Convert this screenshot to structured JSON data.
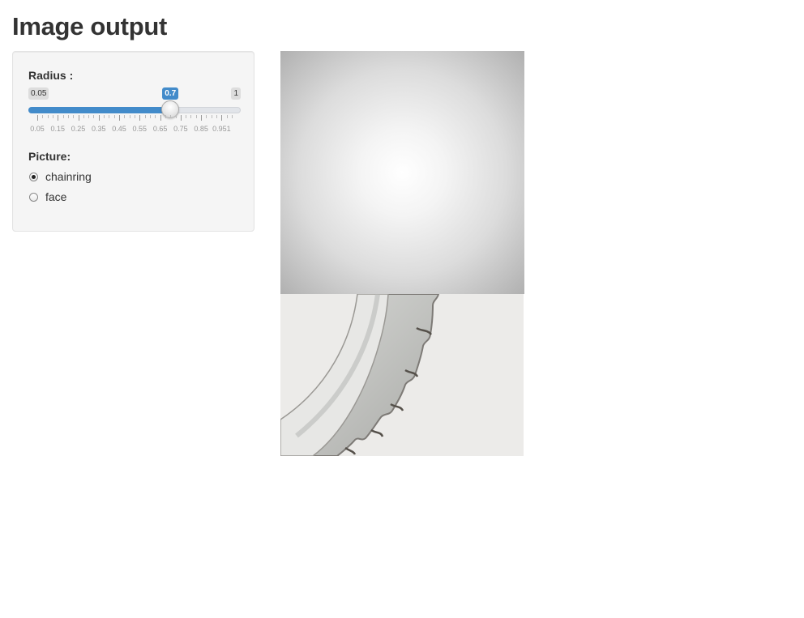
{
  "page": {
    "title": "Image output"
  },
  "sidebar": {
    "radius": {
      "label": "Radius :",
      "min": 0.05,
      "max": 1,
      "min_label": "0.05",
      "max_label": "1",
      "value": 0.7,
      "value_label": "0.7",
      "tick_labels": [
        "0.05",
        "0.15",
        "0.25",
        "0.35",
        "0.45",
        "0.55",
        "0.65",
        "0.75",
        "0.85",
        "0.951"
      ],
      "accent_color": "#428bca"
    },
    "picture": {
      "label": "Picture:",
      "options": [
        {
          "label": "chainring",
          "checked": true
        },
        {
          "label": "face",
          "checked": false
        }
      ]
    }
  },
  "output": {
    "images": [
      {
        "name": "radial-vignette-image"
      },
      {
        "name": "chainring-photo"
      }
    ]
  }
}
